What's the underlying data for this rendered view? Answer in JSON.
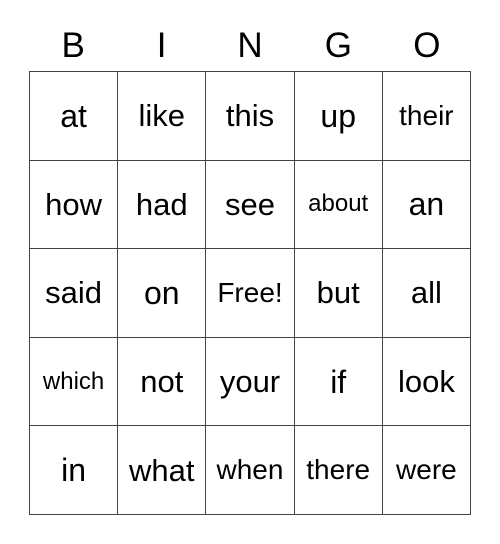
{
  "card": {
    "type": "bingo-card",
    "background_color": "#ffffff",
    "text_color": "#000000",
    "border_color": "#444444",
    "columns": 5,
    "rows": 5
  },
  "header": {
    "letters": [
      "B",
      "I",
      "N",
      "G",
      "O"
    ]
  },
  "grid": {
    "free_space_label": "Free!",
    "free_space_position": {
      "row": 3,
      "column": 3
    },
    "rows": [
      {
        "cells": [
          {
            "word": "at",
            "size": "len-s"
          },
          {
            "word": "like",
            "size": "len-m"
          },
          {
            "word": "this",
            "size": "len-m"
          },
          {
            "word": "up",
            "size": "len-s"
          },
          {
            "word": "their",
            "size": "len-l"
          }
        ]
      },
      {
        "cells": [
          {
            "word": "how",
            "size": "len-m"
          },
          {
            "word": "had",
            "size": "len-m"
          },
          {
            "word": "see",
            "size": "len-m"
          },
          {
            "word": "about",
            "size": "len-xl"
          },
          {
            "word": "an",
            "size": "len-s"
          }
        ]
      },
      {
        "cells": [
          {
            "word": "said",
            "size": "len-m"
          },
          {
            "word": "on",
            "size": "len-s"
          },
          {
            "word": "Free!",
            "size": "len-l"
          },
          {
            "word": "but",
            "size": "len-m"
          },
          {
            "word": "all",
            "size": "len-m"
          }
        ]
      },
      {
        "cells": [
          {
            "word": "which",
            "size": "len-xl"
          },
          {
            "word": "not",
            "size": "len-m"
          },
          {
            "word": "your",
            "size": "len-m"
          },
          {
            "word": "if",
            "size": "len-s"
          },
          {
            "word": "look",
            "size": "len-m"
          }
        ]
      },
      {
        "cells": [
          {
            "word": "in",
            "size": "len-s"
          },
          {
            "word": "what",
            "size": "len-m"
          },
          {
            "word": "when",
            "size": "len-l"
          },
          {
            "word": "there",
            "size": "len-l"
          },
          {
            "word": "were",
            "size": "len-l"
          }
        ]
      }
    ]
  }
}
